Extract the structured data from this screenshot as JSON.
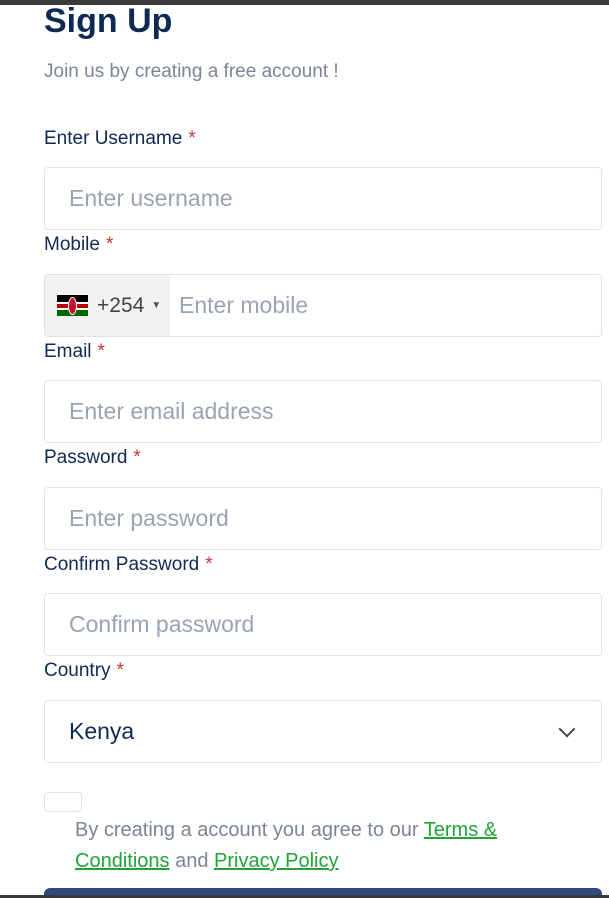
{
  "form": {
    "title": "Sign Up",
    "subtitle": "Join us by creating a free account !",
    "required_mark": "*",
    "username": {
      "label": "Enter Username",
      "placeholder": "Enter username"
    },
    "mobile": {
      "label": "Mobile",
      "country_code": "+254",
      "flag": "kenya-flag",
      "placeholder": "Enter mobile"
    },
    "email": {
      "label": "Email",
      "placeholder": "Enter email address"
    },
    "password": {
      "label": "Password",
      "placeholder": "Enter password"
    },
    "confirm_password": {
      "label": "Confirm Password",
      "placeholder": "Confirm password"
    },
    "country": {
      "label": "Country",
      "selected": "Kenya"
    },
    "agreement": {
      "prefix": "By creating a account you agree to our ",
      "terms_link": "Terms & Conditions",
      "conjunction": " and ",
      "privacy_link": "Privacy Policy",
      "checked": false
    }
  },
  "colors": {
    "heading": "#0f2a52",
    "required": "#d0342c",
    "link": "#21a33a",
    "muted": "#7b8594",
    "button": "#2f4a7f"
  }
}
